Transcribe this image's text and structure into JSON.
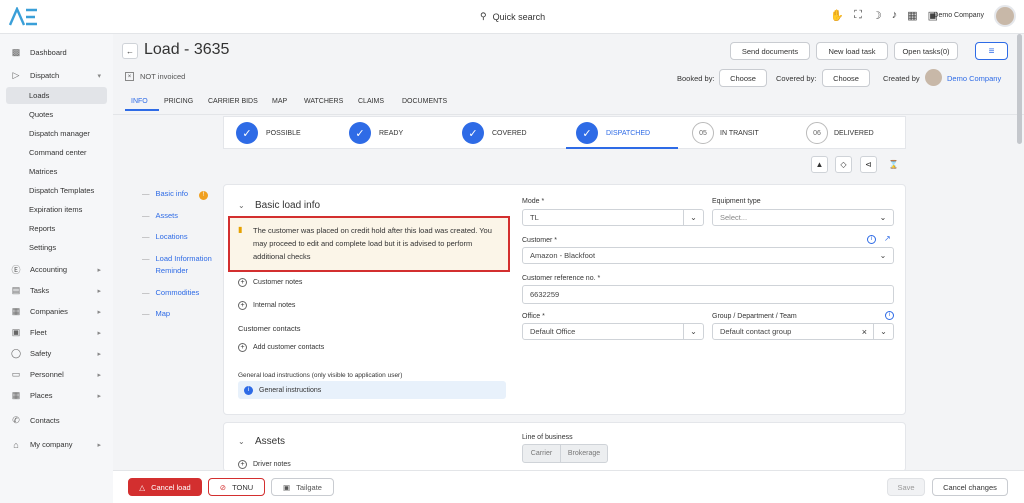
{
  "topbar": {
    "search_label": "Quick search",
    "company": "Demo Company"
  },
  "sidebar": {
    "items": [
      {
        "label": "Dashboard",
        "icon": "bar-chart-icon"
      },
      {
        "label": "Dispatch",
        "icon": "send-icon"
      },
      {
        "label": "Loads"
      },
      {
        "label": "Quotes"
      },
      {
        "label": "Dispatch manager"
      },
      {
        "label": "Command center"
      },
      {
        "label": "Matrices"
      },
      {
        "label": "Dispatch Templates"
      },
      {
        "label": "Expiration items"
      },
      {
        "label": "Reports"
      },
      {
        "label": "Settings"
      },
      {
        "label": "Accounting",
        "icon": "dollar-icon"
      },
      {
        "label": "Tasks",
        "icon": "clipboard-icon"
      },
      {
        "label": "Companies",
        "icon": "building-icon"
      },
      {
        "label": "Fleet",
        "icon": "truck-icon"
      },
      {
        "label": "Safety",
        "icon": "shield-icon"
      },
      {
        "label": "Personnel",
        "icon": "id-card-icon"
      },
      {
        "label": "Places",
        "icon": "map-icon"
      },
      {
        "label": "Contacts",
        "icon": "phone-icon"
      },
      {
        "label": "My company",
        "icon": "home-icon"
      }
    ]
  },
  "header": {
    "title": "Load - 3635",
    "invoice_status": "NOT invoiced",
    "send_documents": "Send documents",
    "new_load_task": "New load task",
    "open_tasks": "Open tasks(0)",
    "booked_by_label": "Booked by:",
    "booked_by_value": "Choose",
    "covered_by_label": "Covered by:",
    "covered_by_value": "Choose",
    "created_by_label": "Created by",
    "created_by_value": "Demo Company"
  },
  "tabs": [
    "INFO",
    "PRICING",
    "CARRIER BIDS",
    "MAP",
    "WATCHERS",
    "CLAIMS",
    "DOCUMENTS"
  ],
  "steps": [
    {
      "label": "POSSIBLE",
      "done": true
    },
    {
      "label": "READY",
      "done": true
    },
    {
      "label": "COVERED",
      "done": true
    },
    {
      "label": "DISPATCHED",
      "done": true
    },
    {
      "num": "05",
      "label": "IN TRANSIT",
      "done": false
    },
    {
      "num": "06",
      "label": "DELIVERED",
      "done": false
    }
  ],
  "leftnav": [
    "Basic info",
    "Assets",
    "Locations",
    "Load Information Reminder",
    "Commodities",
    "Map"
  ],
  "basic_info": {
    "title": "Basic load info",
    "alert": "The customer was placed on credit hold after this load was created. You may proceed to edit and complete load but it is advised to perform additional checks",
    "customer_notes": "Customer notes",
    "internal_notes": "Internal notes",
    "customer_contacts": "Customer contacts",
    "add_customer_contacts": "Add customer contacts",
    "general_instructions_label": "General load instructions (only visible to application user)",
    "general_instructions": "General instructions",
    "mode_label": "Mode *",
    "mode_value": "TL",
    "equipment_label": "Equipment type",
    "equipment_placeholder": "Select...",
    "customer_label": "Customer *",
    "customer_value": "Amazon - Blackfoot",
    "customer_ref_label": "Customer reference no. *",
    "customer_ref_value": "6632259",
    "office_label": "Office *",
    "office_value": "Default Office",
    "group_label": "Group / Department / Team",
    "group_value": "Default contact group"
  },
  "assets": {
    "title": "Assets",
    "driver_notes": "Driver notes",
    "lob_label": "Line of business",
    "lob_options": [
      "Carrier",
      "Brokerage"
    ]
  },
  "bottom": {
    "cancel_load": "Cancel load",
    "tonu": "TONU",
    "tailgate": "Tailgate",
    "save": "Save",
    "cancel_changes": "Cancel changes"
  },
  "colors": {
    "accent": "#2e6be6",
    "danger": "#d32f2f",
    "alert_bg": "#fbf5e8"
  }
}
